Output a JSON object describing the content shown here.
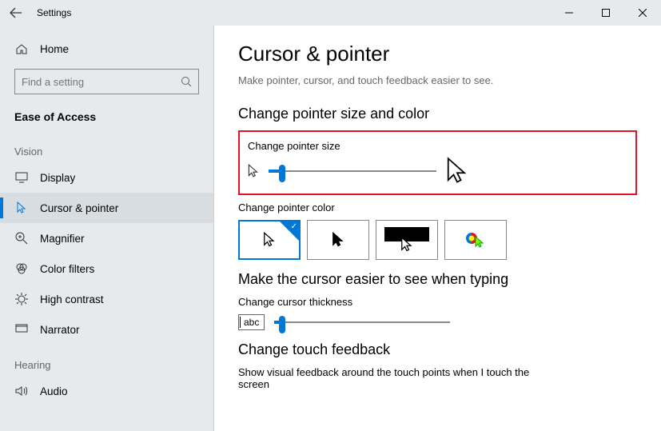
{
  "titlebar": {
    "title": "Settings"
  },
  "sidebar": {
    "home": "Home",
    "search_placeholder": "Find a setting",
    "heading": "Ease of Access",
    "group_vision": "Vision",
    "items_vision": [
      "Display",
      "Cursor & pointer",
      "Magnifier",
      "Color filters",
      "High contrast",
      "Narrator"
    ],
    "group_hearing": "Hearing",
    "items_hearing": [
      "Audio"
    ]
  },
  "main": {
    "title": "Cursor & pointer",
    "subtitle": "Make pointer, cursor, and touch feedback easier to see.",
    "section_size_color": "Change pointer size and color",
    "label_pointer_size": "Change pointer size",
    "label_pointer_color": "Change pointer color",
    "section_cursor": "Make the cursor easier to see when typing",
    "label_cursor_thickness": "Change cursor thickness",
    "abc": "abc",
    "section_touch": "Change touch feedback",
    "touch_text": "Show visual feedback around the touch points when I touch the screen"
  }
}
